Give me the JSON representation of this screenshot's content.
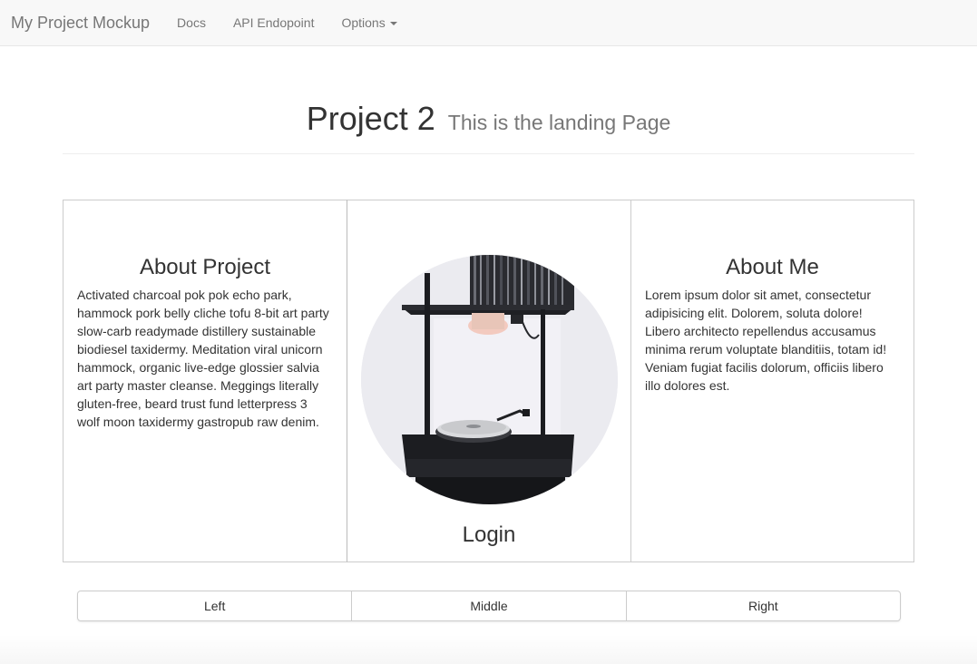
{
  "navbar": {
    "brand": "My Project Mockup",
    "links": [
      {
        "label": "Docs"
      },
      {
        "label": "API Endopoint"
      },
      {
        "label": "Options"
      }
    ]
  },
  "header": {
    "title": "Project 2",
    "subtitle": "This is the landing Page"
  },
  "panels": {
    "left": {
      "heading": "About Project",
      "body": "Activated charcoal pok pok echo park, hammock pork belly cliche tofu 8-bit art party slow-carb readymade distillery sustainable biodiesel taxidermy. Meditation viral unicorn hammock, organic live-edge glossier salvia art party master cleanse. Meggings literally gluten-free, beard trust fund letterpress 3 wolf moon taxidermy gastropub raw denim."
    },
    "middle": {
      "login_label": "Login"
    },
    "right": {
      "heading": "About Me",
      "body": "Lorem ipsum dolor sit amet, consectetur adipisicing elit. Dolorem, soluta dolore! Libero architecto repellendus accusamus minima rerum voluptate blanditiis, totam id! Veniam fugiat facilis dolorum, officiis libero illo dolores est."
    }
  },
  "button_group": {
    "left": "Left",
    "middle": "Middle",
    "right": "Right"
  },
  "colors": {
    "navbar_bg": "#f8f8f8",
    "nav_text": "#777777",
    "text": "#333333",
    "border": "#cccccc"
  }
}
